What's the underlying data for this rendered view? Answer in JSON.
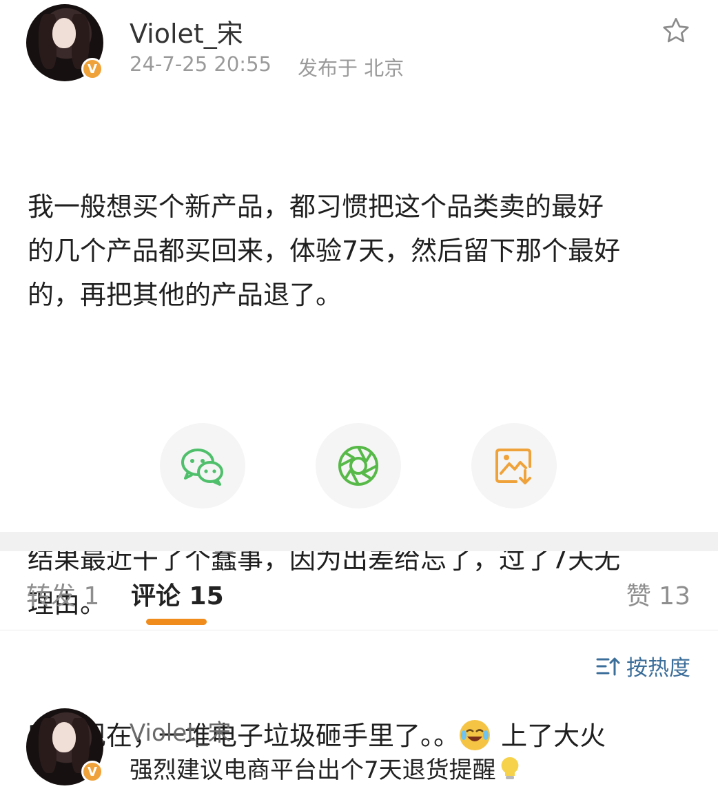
{
  "post": {
    "author": "Violet_宋",
    "verified_badge": "V",
    "timestamp": "24-7-25 20:55",
    "location": "发布于 北京",
    "paragraph1": "我一般想买个新产品，都习惯把这个品类卖的最好\n的几个产品都买回来，体验7天，然后留下那个最好\n的，再把其他的产品退了。",
    "paragraph2": "结果最近干了个蠢事，因为出差给忘了，过了7天无\n理由。",
    "paragraph3_before_emoji": "所以现在，一堆电子垃圾砸手里了。。",
    "paragraph3_after_emoji": " 上了大火"
  },
  "share": {
    "icons": [
      "wechat-icon",
      "moments-icon",
      "save-image-icon"
    ],
    "colors": {
      "wechat": "#4fbf6b",
      "moments": "#57b948",
      "save": "#f0a23a"
    }
  },
  "tabs": {
    "repost": "转发 1",
    "comments": "评论 15",
    "likes": "赞 13"
  },
  "sort": {
    "label": "按热度"
  },
  "comment": {
    "author": "Violet_宋",
    "text": "强烈建议电商平台出个7天退货提醒"
  },
  "colors": {
    "accent": "#f08c1c",
    "link": "#3c6e9a",
    "badge": "#f0a23a"
  }
}
